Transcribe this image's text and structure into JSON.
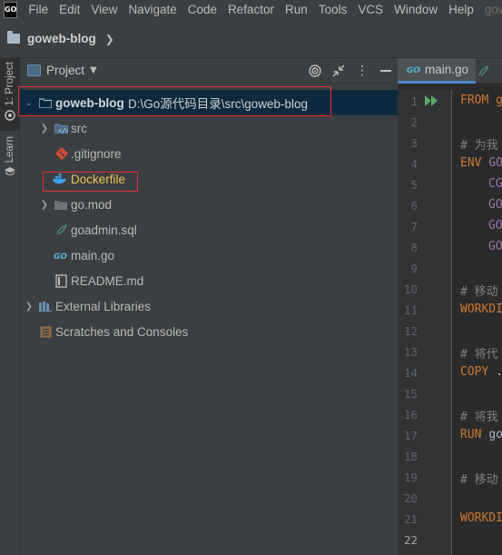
{
  "menubar": {
    "logo": "GO",
    "items": [
      "File",
      "Edit",
      "View",
      "Navigate",
      "Code",
      "Refactor",
      "Run",
      "Tools",
      "VCS",
      "Window",
      "Help",
      "gowe"
    ]
  },
  "navbar": {
    "project": "goweb-blog"
  },
  "toolstrip": {
    "project_tab": "1: Project",
    "learn_tab": "Learn"
  },
  "project_panel": {
    "title": "Project",
    "root": {
      "name": "goweb-blog",
      "path": "D:\\Go源代码目录\\src\\goweb-blog"
    },
    "items": [
      {
        "name": "src",
        "kind": "folder"
      },
      {
        "name": ".gitignore",
        "kind": "git"
      },
      {
        "name": "Dockerfile",
        "kind": "docker"
      },
      {
        "name": "go.mod",
        "kind": "gomod"
      },
      {
        "name": "goadmin.sql",
        "kind": "sql"
      },
      {
        "name": "main.go",
        "kind": "go"
      },
      {
        "name": "README.md",
        "kind": "md"
      }
    ],
    "external": "External Libraries",
    "scratches": "Scratches and Consoles"
  },
  "editor": {
    "tab": "main.go",
    "line_numbers": [
      "1",
      "2",
      "3",
      "4",
      "5",
      "6",
      "7",
      "8",
      "9",
      "10",
      "11",
      "12",
      "13",
      "14",
      "15",
      "16",
      "17",
      "18",
      "19",
      "20",
      "21",
      "22"
    ],
    "current_line": "22",
    "code": {
      "l1": "FROM g",
      "l3": "# 为我",
      "l4_kw": "ENV",
      "l4_var": "GO",
      "l5": "CG",
      "l6": "GO",
      "l7": "GO",
      "l8": "GO",
      "l10": "# 移动",
      "l11": "WORKDI",
      "l13": "# 将代",
      "l14_kw": "COPY",
      "l14_tx": ".",
      "l16": "# 将我",
      "l17_kw": "RUN",
      "l17_tx": "go",
      "l19": "# 移动",
      "l21": "WORKDI"
    }
  },
  "colors": {
    "accent": "#4a88c7",
    "highlight_box": "#e0303a",
    "keyword": "#cc7832",
    "comment": "#808080",
    "env_var": "#9876aa"
  }
}
